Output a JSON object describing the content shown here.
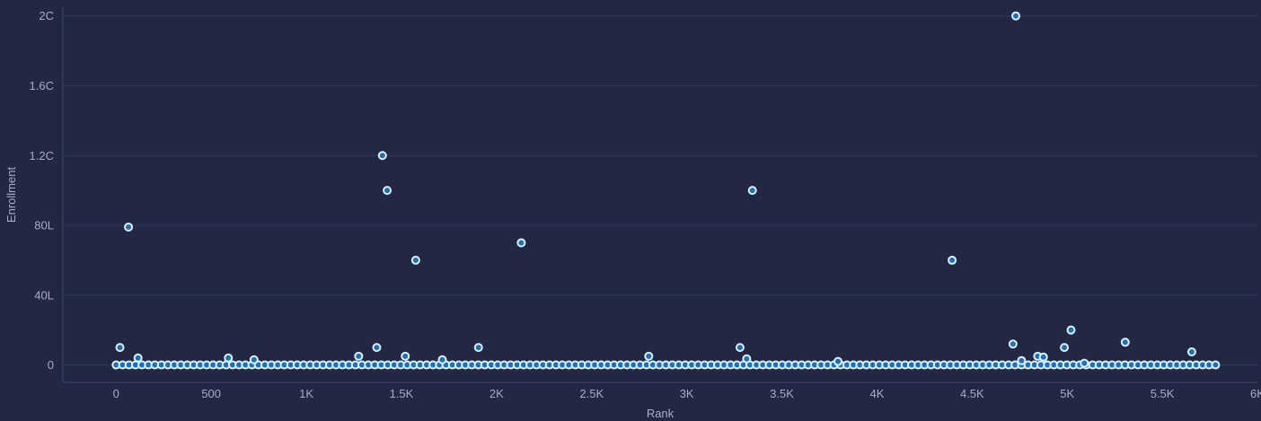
{
  "chart_data": {
    "type": "scatter",
    "title": "",
    "xlabel": "Rank",
    "ylabel": "Enrollment",
    "xlim": [
      -280,
      6000
    ],
    "ylim": [
      -10000000,
      205000000
    ],
    "x_ticks": [
      {
        "value": 0,
        "label": "0"
      },
      {
        "value": 500,
        "label": "500"
      },
      {
        "value": 1000,
        "label": "1K"
      },
      {
        "value": 1500,
        "label": "1.5K"
      },
      {
        "value": 2000,
        "label": "2K"
      },
      {
        "value": 2500,
        "label": "2.5K"
      },
      {
        "value": 3000,
        "label": "3K"
      },
      {
        "value": 3500,
        "label": "3.5K"
      },
      {
        "value": 4000,
        "label": "4K"
      },
      {
        "value": 4500,
        "label": "4.5K"
      },
      {
        "value": 5000,
        "label": "5K"
      },
      {
        "value": 5500,
        "label": "5.5K"
      },
      {
        "value": 6000,
        "label": "6K"
      }
    ],
    "y_ticks": [
      {
        "value": 0,
        "label": "0"
      },
      {
        "value": 40000000,
        "label": "40L"
      },
      {
        "value": 80000000,
        "label": "80L"
      },
      {
        "value": 120000000,
        "label": "1.2C"
      },
      {
        "value": 160000000,
        "label": "1.6C"
      },
      {
        "value": 200000000,
        "label": "2C"
      }
    ],
    "grid": true,
    "baseline": {
      "x_start": 0,
      "x_end": 5780,
      "step": 34,
      "value": 0
    },
    "outliers": [
      [
        20,
        10000000
      ],
      [
        65,
        79000000
      ],
      [
        115,
        4000000
      ],
      [
        590,
        4000000
      ],
      [
        725,
        3000000
      ],
      [
        1275,
        5000000
      ],
      [
        1370,
        10000000
      ],
      [
        1400,
        120000000
      ],
      [
        1425,
        100000000
      ],
      [
        1520,
        5000000
      ],
      [
        1575,
        60000000
      ],
      [
        1715,
        3000000
      ],
      [
        1905,
        10000000
      ],
      [
        2130,
        70000000
      ],
      [
        2800,
        5000000
      ],
      [
        3280,
        10000000
      ],
      [
        3315,
        3500000
      ],
      [
        3345,
        100000000
      ],
      [
        3795,
        2000000
      ],
      [
        4395,
        60000000
      ],
      [
        4715,
        12000000
      ],
      [
        4730,
        200000000
      ],
      [
        4760,
        2500000
      ],
      [
        4845,
        5000000
      ],
      [
        4875,
        4500000
      ],
      [
        4985,
        10000000
      ],
      [
        5020,
        20000000
      ],
      [
        5090,
        1000000
      ],
      [
        5305,
        13000000
      ],
      [
        5655,
        7500000
      ]
    ]
  }
}
